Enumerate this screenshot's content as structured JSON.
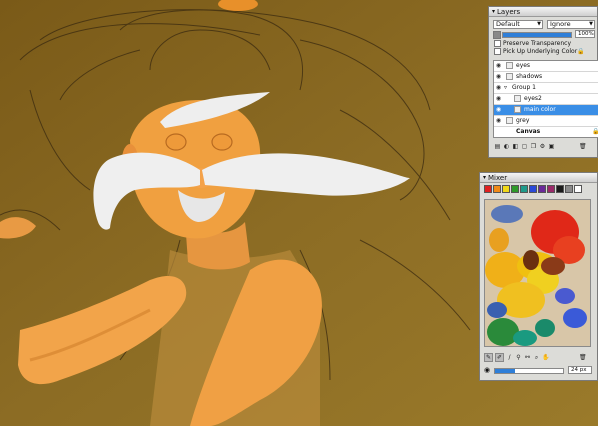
{
  "layers_panel": {
    "title": "Layers",
    "composite_method": "Default",
    "composite_depth": "Ignore",
    "opacity_value": "100%",
    "opacity_fraction": 1.0,
    "preserve_transparency": "Preserve Transparency",
    "pick_up_underlying": "Pick Up Underlying Color",
    "layers": [
      {
        "name": "eyes",
        "visible": true,
        "active": false
      },
      {
        "name": "shadows",
        "visible": true,
        "active": false
      },
      {
        "name": "Group 1",
        "visible": true,
        "active": false
      },
      {
        "name": "eyes2",
        "visible": true,
        "active": false
      },
      {
        "name": "main color",
        "visible": true,
        "active": true
      },
      {
        "name": "grey",
        "visible": true,
        "active": false
      },
      {
        "name": "Canvas",
        "visible": false,
        "active": false
      }
    ]
  },
  "mixer_panel": {
    "title": "Mixer",
    "swatches": [
      "#e02020",
      "#f08a18",
      "#f0d818",
      "#2e9a2a",
      "#1e9a8a",
      "#2a4ad8",
      "#6a2a9a",
      "#9a2a6a",
      "#1a1a1a",
      "#8a8a8a",
      "#ffffff"
    ],
    "brush_size_value": "24 px",
    "brush_size_fraction": 0.3
  },
  "colors": {
    "canvas_bg": "#8a6a22",
    "selection": "#3a8ee6",
    "panel_bg": "#dcdcd8"
  }
}
